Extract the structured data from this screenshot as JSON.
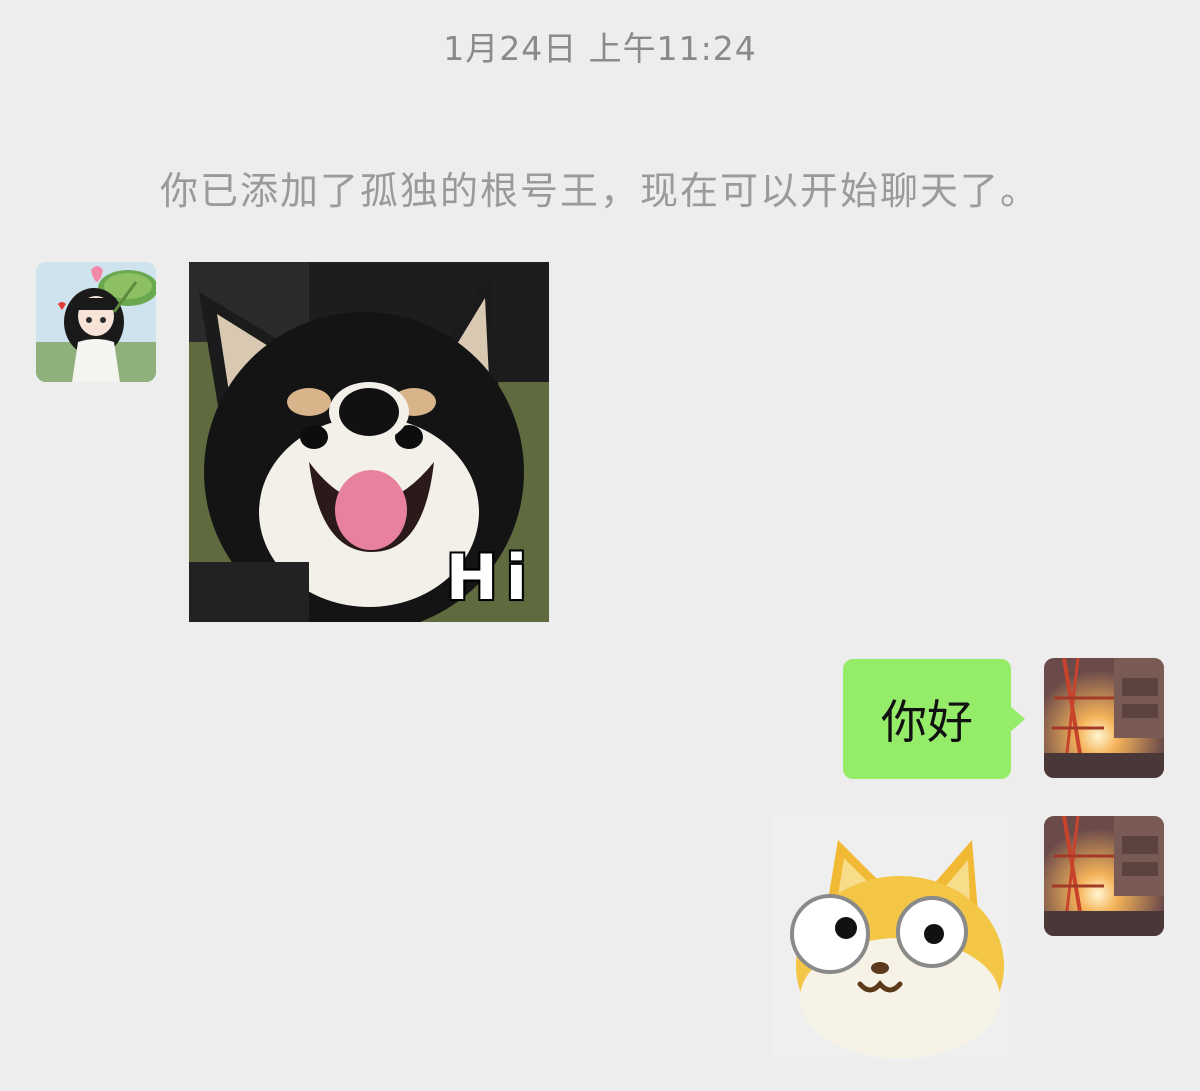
{
  "chat": {
    "timestamp": "1月24日 上午11:24",
    "system_notice": "你已添加了孤独的根号王，现在可以开始聊天了。",
    "messages": [
      {
        "sender": "contact",
        "type": "sticker",
        "sticker_icon": "shiba-dog-sticker",
        "caption": "Hi"
      },
      {
        "sender": "self",
        "type": "text",
        "text": "你好"
      },
      {
        "sender": "self",
        "type": "sticker",
        "sticker_icon": "cartoon-cat-sticker"
      }
    ]
  },
  "colors": {
    "background": "#ededed",
    "self_bubble": "#95ec69",
    "system_text": "#9a9a9a"
  },
  "icons": {
    "contact_avatar": "anime-girl-lotus-avatar",
    "self_avatar": "sunset-construction-avatar"
  }
}
